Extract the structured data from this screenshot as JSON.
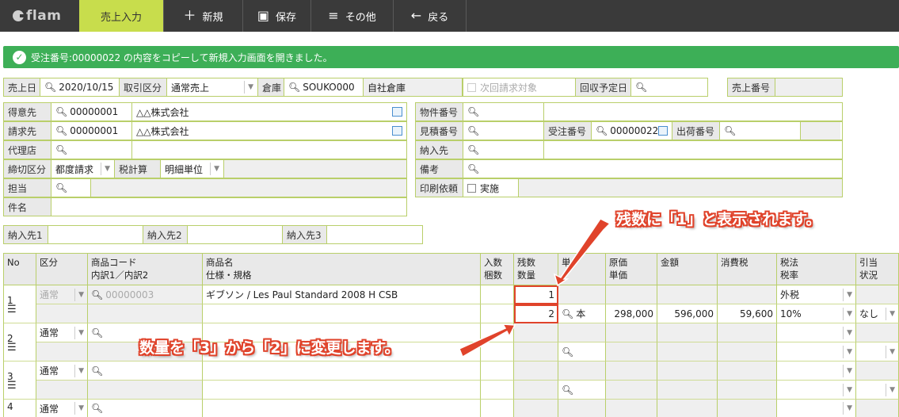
{
  "topbar": {
    "logo": "flam",
    "buttons": [
      {
        "label": "売上入力",
        "icon": ""
      },
      {
        "label": "新規",
        "icon": "plus-icon"
      },
      {
        "label": "保存",
        "icon": "save-icon"
      },
      {
        "label": "その他",
        "icon": "menu-icon"
      },
      {
        "label": "戻る",
        "icon": "back-arrow-icon"
      }
    ]
  },
  "banner": {
    "message": "受注番号:00000022 の内容をコピーして新規入力画面を開きました。"
  },
  "header_row": {
    "sales_date_label": "売上日",
    "sales_date": "2020/10/15",
    "trade_type_label": "取引区分",
    "trade_type": "通常売上",
    "warehouse_label": "倉庫",
    "warehouse_code": "SOUKO000",
    "warehouse_name": "自社倉庫",
    "next_billing_label": "次回請求対象",
    "collection_date_label": "回収予定日",
    "sales_number_label": "売上番号"
  },
  "left_form": {
    "customer_label": "得意先",
    "customer_code": "00000001",
    "customer_name": "△△株式会社",
    "billing_label": "請求先",
    "billing_code": "00000001",
    "billing_name": "△△株式会社",
    "agent_label": "代理店",
    "closing_label": "締切区分",
    "closing_value": "都度請求",
    "tax_calc_label": "税計算",
    "tax_calc_value": "明細単位",
    "person_label": "担当",
    "subject_label": "件名"
  },
  "right_form": {
    "property_label": "物件番号",
    "estimate_label": "見積番号",
    "order_label": "受注番号",
    "order_value": "00000022",
    "shipping_label": "出荷番号",
    "delivery_label": "納入先",
    "remarks_label": "備考",
    "print_label": "印刷依頼",
    "print_option": "実施"
  },
  "delivery_row": {
    "d1": "納入先1",
    "d2": "納入先2",
    "d3": "納入先3"
  },
  "table": {
    "headers": {
      "no": "No",
      "kubun": "区分",
      "code1": "商品コード",
      "code2": "内訳1／内訳2",
      "name1": "商品名",
      "name2": "仕様・規格",
      "irisu1": "入数",
      "irisu2": "梱数",
      "zan1": "残数",
      "zan2": "数量",
      "unit": "単",
      "cost1": "原価",
      "cost2": "単価",
      "amount": "金額",
      "tax": "消費税",
      "taxlaw1": "税法",
      "taxlaw2": "税率",
      "hiki1": "引当",
      "hiki2": "状況"
    },
    "rows": [
      {
        "no": "1",
        "kubun": "通常",
        "code": "00000003",
        "name": "ギブソン / Les Paul Standard 2008 H CSB",
        "remaining": "1",
        "qty": "2",
        "unit": "本",
        "price": "298,000",
        "amount": "596,000",
        "tax": "59,600",
        "taxlaw": "外税",
        "rate": "10%",
        "status": "なし"
      },
      {
        "no": "2",
        "kubun": "通常"
      },
      {
        "no": "3",
        "kubun": "通常"
      },
      {
        "no": "4",
        "kubun": "通常"
      }
    ]
  },
  "callouts": {
    "top": "残数に「1」と表示されます。",
    "bottom": "数量を「3」から「2」に変更します。"
  },
  "colors": {
    "accent": "#c8dd4c",
    "success": "#3daf57",
    "highlight": "#e0432b",
    "border": "#b9cf6a"
  }
}
